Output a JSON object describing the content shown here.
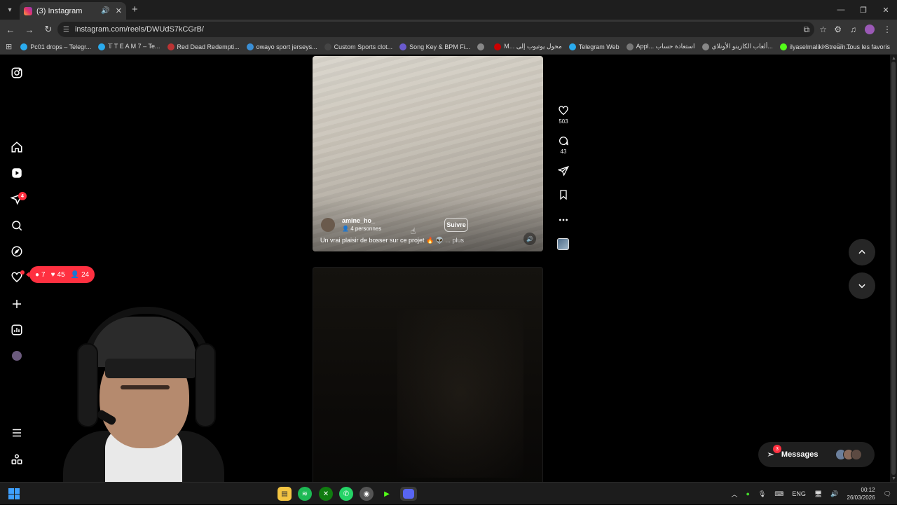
{
  "browser": {
    "tab_title": "(3) Instagram",
    "url": "instagram.com/reels/DWUdS7kCGrB/",
    "bookmarks": [
      {
        "label": "Pc01 drops – Telegr...",
        "color": "#2aabee"
      },
      {
        "label": "𝕋 T E A M 7 – Te...",
        "color": "#2aabee"
      },
      {
        "label": "Red Dead Redempti...",
        "color": "#b33"
      },
      {
        "label": "owayo sport jerseys...",
        "color": "#3a8fd6"
      },
      {
        "label": "Custom Sports clot...",
        "color": "#444"
      },
      {
        "label": "Song Key & BPM Fi...",
        "color": "#6a5acd"
      },
      {
        "label": "",
        "color": "#888"
      },
      {
        "label": "M... محول يوتيوب إلى",
        "color": "#c00"
      },
      {
        "label": "Telegram Web",
        "color": "#2aabee"
      },
      {
        "label": "Appl... استعادة حساب",
        "color": "#777"
      },
      {
        "label": "ألعاب الكازينو الأونلاي...",
        "color": "#888"
      },
      {
        "label": "ilyaselmaliki Stream...",
        "color": "#53fc18"
      }
    ],
    "bookmarks_all": "Tous les favoris"
  },
  "sidebar": {
    "notifications_badge": "4",
    "activity": {
      "comments": "7",
      "likes": "45",
      "follows": "24"
    }
  },
  "reel": {
    "username": "amine_ho_",
    "collaborators": "4 personnes",
    "follow_label": "Suivre",
    "caption": "Un vrai plaisir de bosser sur ce projet",
    "caption_more": "... plus",
    "likes": "503",
    "comments": "43"
  },
  "messages": {
    "label": "Messages",
    "badge": "3"
  },
  "taskbar": {
    "lang": "ENG",
    "time": "00:12",
    "date": "26/03/2026"
  },
  "colors": {
    "accent_red": "#ff3040",
    "background": "#000000"
  }
}
